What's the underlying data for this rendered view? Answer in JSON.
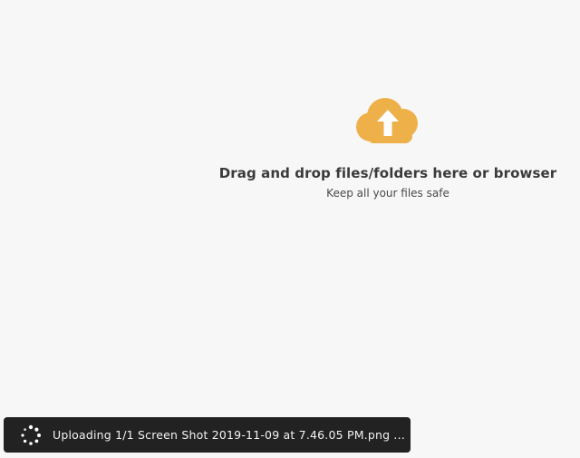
{
  "dropzone": {
    "title": "Drag and drop files/folders here or browser",
    "subtitle": "Keep all your files safe",
    "icon": "cloud-upload-icon",
    "icon_color": "#eeb14a"
  },
  "upload_toast": {
    "icon": "loading-spinner-icon",
    "message": "Uploading 1/1 Screen Shot 2019-11-09 at 7.46.05 PM.png ..."
  }
}
